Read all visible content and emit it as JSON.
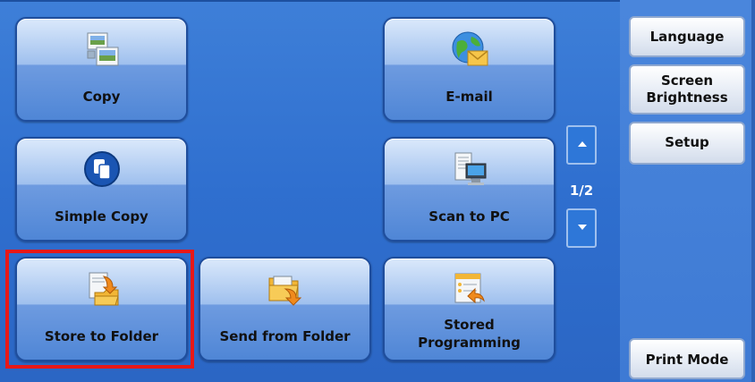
{
  "tiles": {
    "copy": {
      "label": "Copy"
    },
    "email": {
      "label": "E-mail"
    },
    "simple_copy": {
      "label": "Simple Copy"
    },
    "scan_to_pc": {
      "label": "Scan to PC"
    },
    "store_to_folder": {
      "label": "Store to Folder"
    },
    "send_from_folder": {
      "label": "Send from Folder"
    },
    "stored_programming": {
      "label_line1": "Stored",
      "label_line2": "Programming"
    }
  },
  "pager": {
    "indicator": "1/2"
  },
  "side_menu": {
    "language": "Language",
    "screen_brightness_line1": "Screen",
    "screen_brightness_line2": "Brightness",
    "setup": "Setup",
    "print_mode": "Print Mode"
  },
  "colors": {
    "highlight": "#e81818",
    "panel": "#2f6fcf"
  }
}
